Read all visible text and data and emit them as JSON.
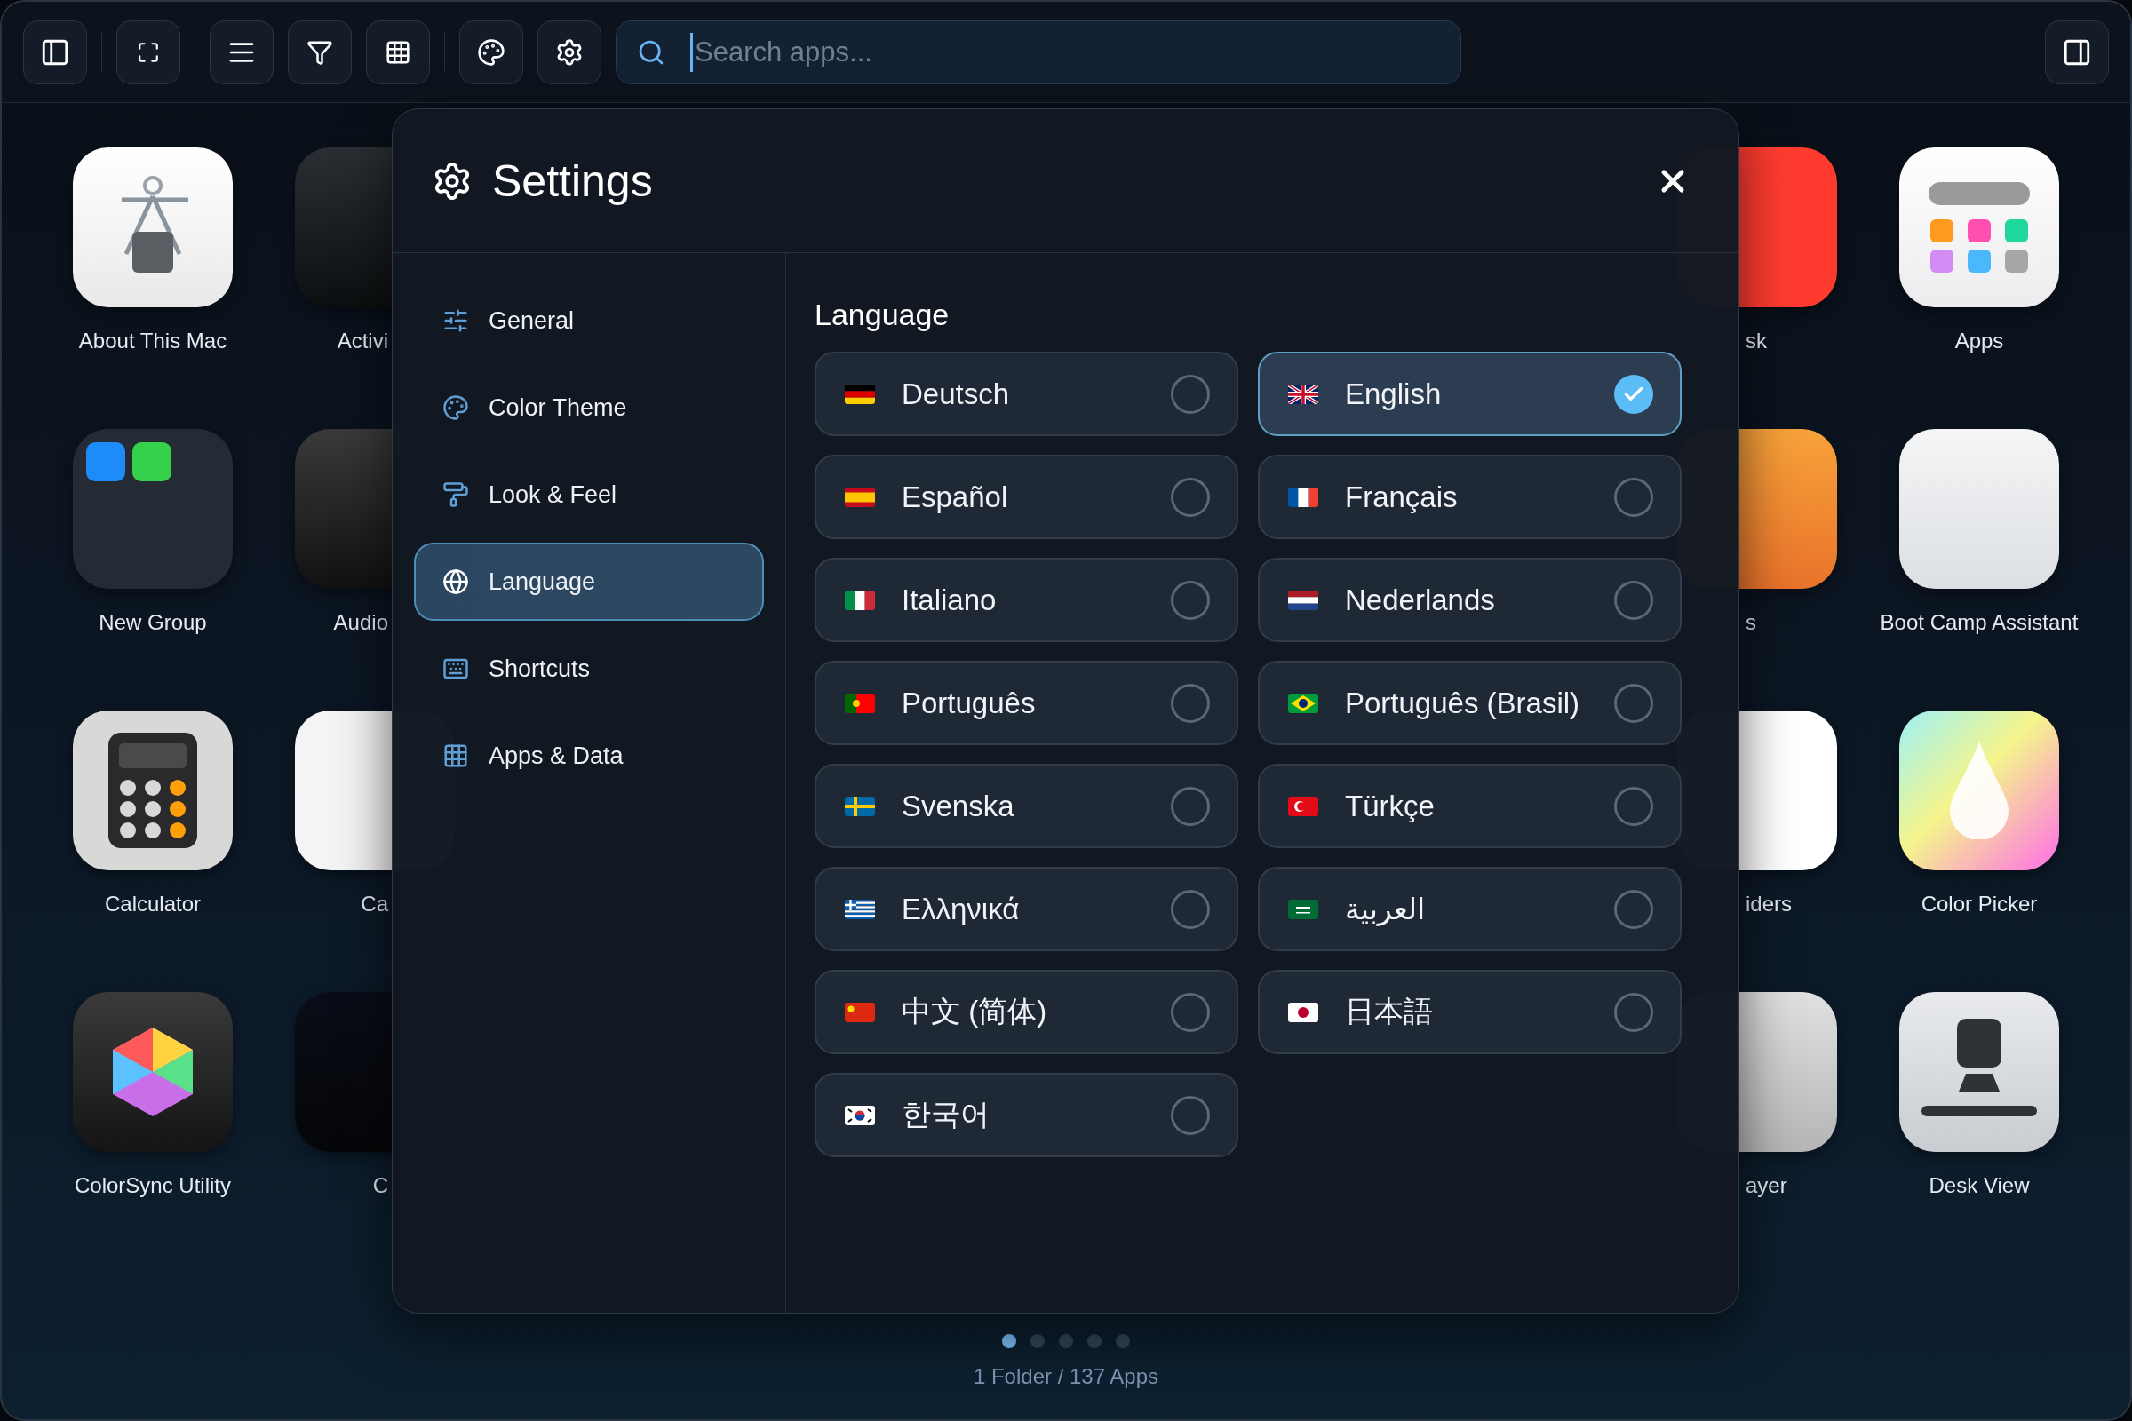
{
  "toolbar": {
    "search": {
      "placeholder": "Search apps..."
    }
  },
  "apps": [
    {
      "label": "About This Mac"
    },
    {
      "label": "Activi"
    },
    {
      "label": "sk"
    },
    {
      "label": "Apps"
    },
    {
      "label": "New Group"
    },
    {
      "label": "Audio"
    },
    {
      "label": "s"
    },
    {
      "label": "Boot Camp Assistant"
    },
    {
      "label": "Calculator"
    },
    {
      "label": "Ca"
    },
    {
      "label": "iders"
    },
    {
      "label": "Color Picker"
    },
    {
      "label": "ColorSync Utility"
    },
    {
      "label": "C"
    },
    {
      "label": "ayer"
    },
    {
      "label": "Desk View"
    }
  ],
  "pagination": {
    "dots": [
      {
        "selected": true
      },
      {
        "selected": false
      },
      {
        "selected": false
      },
      {
        "selected": false
      },
      {
        "selected": false
      }
    ],
    "summary": "1 Folder / 137 Apps"
  },
  "settings": {
    "title": "Settings",
    "nav": [
      {
        "label": "General",
        "selected": false
      },
      {
        "label": "Color Theme",
        "selected": false
      },
      {
        "label": "Look & Feel",
        "selected": false
      },
      {
        "label": "Language",
        "selected": true
      },
      {
        "label": "Shortcuts",
        "selected": false
      },
      {
        "label": "Apps & Data",
        "selected": false
      }
    ],
    "section_title": "Language",
    "languages": [
      {
        "label": "Deutsch",
        "selected": false
      },
      {
        "label": "English",
        "selected": true
      },
      {
        "label": "Español",
        "selected": false
      },
      {
        "label": "Français",
        "selected": false
      },
      {
        "label": "Italiano",
        "selected": false
      },
      {
        "label": "Nederlands",
        "selected": false
      },
      {
        "label": "Português",
        "selected": false
      },
      {
        "label": "Português (Brasil)",
        "selected": false
      },
      {
        "label": "Svenska",
        "selected": false
      },
      {
        "label": "Türkçe",
        "selected": false
      },
      {
        "label": "Ελληνικά",
        "selected": false
      },
      {
        "label": "العربية",
        "selected": false
      },
      {
        "label": "中文 (简体)",
        "selected": false
      },
      {
        "label": "日本語",
        "selected": false
      },
      {
        "label": "한국어",
        "selected": false
      }
    ]
  }
}
